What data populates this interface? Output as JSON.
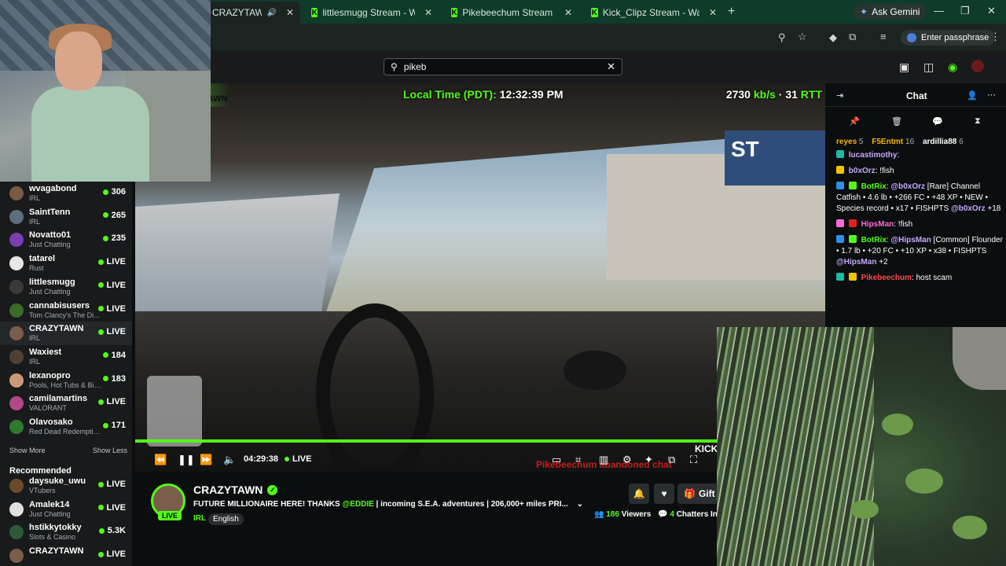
{
  "browser": {
    "tabs": [
      {
        "title": "CRAZYTAWN Stream - Watc",
        "active": true
      },
      {
        "title": "littlesmugg Stream - Watch Live"
      },
      {
        "title": "Pikebeechum Stream - Watch L"
      },
      {
        "title": "Kick_Clipz Stream - Watch Live"
      }
    ],
    "gemini_label": "Ask Gemini",
    "passphrase_label": "Enter passphrase"
  },
  "header": {
    "search_value": "pikeb"
  },
  "sidebar": {
    "following": [
      {
        "name": "wvagabond",
        "category": "IRL",
        "stat": "306",
        "avatar": "#7b5a43"
      },
      {
        "name": "SaintTenn",
        "category": "IRL",
        "stat": "265",
        "avatar": "#5b6f7a"
      },
      {
        "name": "Novatto01",
        "category": "Just Chatting",
        "stat": "235",
        "avatar": "#7b3fb0"
      },
      {
        "name": "tatarel",
        "category": "Rust",
        "stat": "LIVE",
        "avatar": "#e6e6e6"
      },
      {
        "name": "littlesmugg",
        "category": "Just Chatting",
        "stat": "LIVE",
        "avatar": "#3a3a3a"
      },
      {
        "name": "cannabisusers",
        "category": "Tom Clancy's The Di...",
        "stat": "LIVE",
        "avatar": "#3b6b2a"
      },
      {
        "name": "CRAZYTAWN",
        "category": "IRL",
        "stat": "LIVE",
        "avatar": "#7a5d4a",
        "active": true
      },
      {
        "name": "Waxiest",
        "category": "IRL",
        "stat": "184",
        "avatar": "#4e4037"
      },
      {
        "name": "lexanopro",
        "category": "Pools, Hot Tubs & Bikinis",
        "stat": "183",
        "avatar": "#c99a7a"
      },
      {
        "name": "camilamartins",
        "category": "VALORANT",
        "stat": "LIVE",
        "avatar": "#b0488a"
      },
      {
        "name": "Olavosako",
        "category": "Red Dead Redemption II",
        "stat": "171",
        "avatar": "#2e7a2e"
      }
    ],
    "show_more": "Show More",
    "show_less": "Show Less",
    "recommended_title": "Recommended",
    "recommended": [
      {
        "name": "daysuke_uwu",
        "category": "VTubers",
        "stat": "LIVE",
        "avatar": "#6b4a2a"
      },
      {
        "name": "Amalek14",
        "category": "Just Chatting",
        "stat": "LIVE",
        "avatar": "#e0e0e0"
      },
      {
        "name": "hstikkytokky",
        "category": "Slots & Casino",
        "stat": "5.3K",
        "avatar": "#2e5a3a"
      },
      {
        "name": "CRAZYTAWN",
        "category": "",
        "stat": "LIVE",
        "avatar": "#7a5d4a"
      }
    ]
  },
  "video": {
    "local_time_label": "Local Time (PDT):",
    "local_time": "12:32:39 PM",
    "bitrate": "2730",
    "bitrate_unit": "kb/s",
    "rtt": "· 31",
    "rtt_unit": "RTT",
    "elapsed": "04:29:38",
    "live_label": "LIVE",
    "ticker_text": "Pikebeechum abandoned chat",
    "kick_text": "KICK"
  },
  "channel": {
    "name": "CRAZYTAWN",
    "live_badge": "LIVE",
    "title_prefix": "FUTURE MILLIONAIRE HERE! THANKS ",
    "title_mention": "@EDDIE",
    "title_suffix": " | incoming S.E.A. adventures | 206,000+ miles PRI...",
    "category": "IRL",
    "language": "English",
    "gift_label": "Gift S",
    "viewers": "186",
    "viewers_label": "Viewers",
    "chatters": "4",
    "chatters_label": "Chatters In"
  },
  "chat": {
    "title": "Chat",
    "gifters": [
      {
        "name": "reyes",
        "count": "5",
        "color": "#f5b400"
      },
      {
        "name": "F5Entmt",
        "count": "16",
        "color": "#f5b400"
      },
      {
        "name": "ardillia88",
        "count": "6",
        "color": "#ffffff"
      }
    ],
    "messages": [
      {
        "user": "lucastimothy",
        "color": "#c7a7ff",
        "sep": ":",
        "text": ""
      },
      {
        "user": "b0xOrz",
        "color": "#c7a7ff",
        "sep": ":",
        "text": " !fish"
      },
      {
        "user": "BotRix",
        "color": "#53fc18",
        "sep": ":",
        "mention": "@b0xOrz",
        "text": " [Rare] Channel Catfish • 4.6 lb • +266 FC • +48 XP • NEW • Species record • x17 • FISHPTS ",
        "mention2": "@b0xOrz",
        "tail": " +18"
      },
      {
        "user": "HipsMan",
        "color": "#ff6ad5",
        "sep": ":",
        "text": " !fish"
      },
      {
        "user": "BotRix",
        "color": "#53fc18",
        "sep": ":",
        "mention": "@HipsMan",
        "text": " [Common] Flounder • 1.7 lb • +20 FC • +10 XP • x38 • FISHPTS ",
        "mention2": "@HipsMan",
        "tail": " +2"
      },
      {
        "user": "Pikebeechum",
        "color": "#ff4a4a",
        "sep": ":",
        "text": " host scam"
      }
    ]
  }
}
